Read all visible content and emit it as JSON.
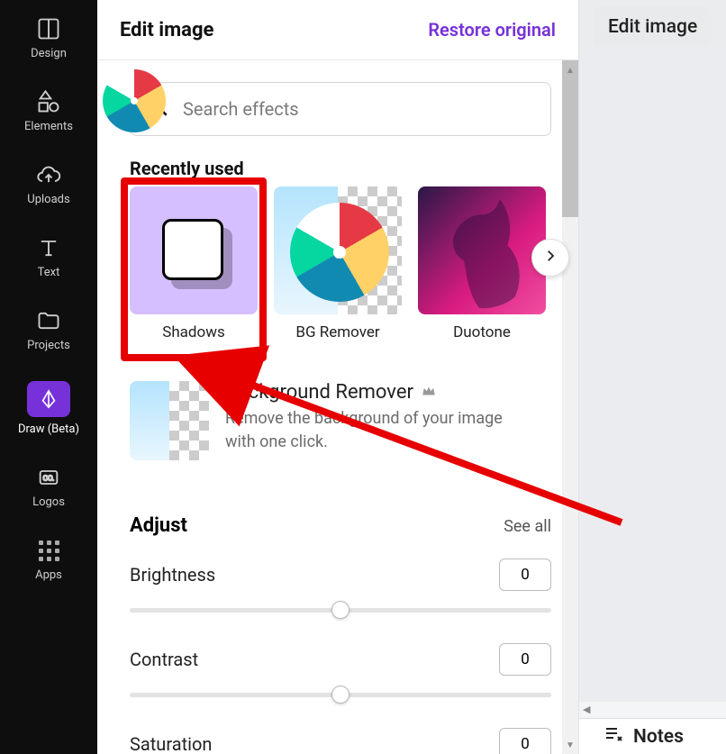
{
  "sidebar": {
    "items": [
      {
        "label": "Design"
      },
      {
        "label": "Elements"
      },
      {
        "label": "Uploads"
      },
      {
        "label": "Text"
      },
      {
        "label": "Projects"
      },
      {
        "label": "Draw (Beta)"
      },
      {
        "label": "Logos"
      },
      {
        "label": "Apps"
      }
    ]
  },
  "panel": {
    "title": "Edit image",
    "restore_label": "Restore original",
    "search_placeholder": "Search effects",
    "recently_used_heading": "Recently used",
    "effects": [
      {
        "label": "Shadows"
      },
      {
        "label": "BG Remover"
      },
      {
        "label": "Duotone"
      }
    ],
    "featured": {
      "title": "Background Remover",
      "desc": "Remove the background of your image with one click."
    },
    "adjust": {
      "heading": "Adjust",
      "see_all": "See all",
      "rows": [
        {
          "label": "Brightness",
          "value": "0"
        },
        {
          "label": "Contrast",
          "value": "0"
        },
        {
          "label": "Saturation",
          "value": "0"
        }
      ]
    }
  },
  "right": {
    "edit_image_btn": "Edit image",
    "notes_label": "Notes"
  }
}
